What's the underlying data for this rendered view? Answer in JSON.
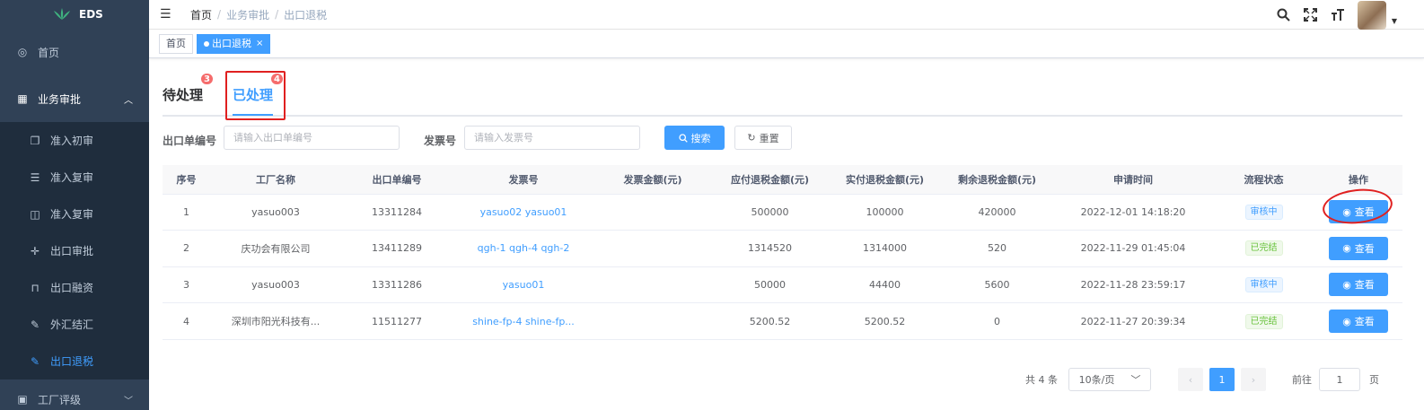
{
  "app": {
    "name": "EDS"
  },
  "sidebar": {
    "items": [
      {
        "label": "首页",
        "icon": "dashboard-icon"
      },
      {
        "label": "业务审批",
        "icon": "table-icon",
        "expanded": true,
        "children": [
          {
            "label": "准入初审",
            "icon": "copy-doc-icon"
          },
          {
            "label": "准入复审",
            "icon": "list-icon"
          },
          {
            "label": "准入复审",
            "icon": "book-icon"
          },
          {
            "label": "出口审批",
            "icon": "move-icon"
          },
          {
            "label": "出口融资",
            "icon": "finance-icon"
          },
          {
            "label": "外汇结汇",
            "icon": "edit-doc-icon"
          },
          {
            "label": "出口退税",
            "icon": "edit-doc-icon",
            "active": true
          }
        ]
      },
      {
        "label": "工厂评级",
        "icon": "grade-icon"
      }
    ]
  },
  "breadcrumb": [
    "首页",
    "业务审批",
    "出口退税"
  ],
  "tags": [
    {
      "label": "首页",
      "active": false
    },
    {
      "label": "出口退税",
      "active": true,
      "close": "×"
    }
  ],
  "tabs": [
    {
      "label": "待处理",
      "badge": "3"
    },
    {
      "label": "已处理",
      "badge": "4",
      "active": true
    }
  ],
  "search": {
    "export_no_label": "出口单编号",
    "export_no_placeholder": "请输入出口单编号",
    "invoice_label": "发票号",
    "invoice_placeholder": "请输入发票号",
    "search_button": "搜索",
    "reset_button": "重置"
  },
  "table": {
    "headers": [
      "序号",
      "工厂名称",
      "出口单编号",
      "发票号",
      "发票金额(元)",
      "应付退税金额(元)",
      "实付退税金额(元)",
      "剩余退税金额(元)",
      "申请时间",
      "流程状态",
      "操作"
    ],
    "rows": [
      {
        "no": "1",
        "factory": "yasuo003",
        "export_no": "13311284",
        "invoice": "yasuo02 yasuo01",
        "invoice_amount": "",
        "payable": "500000",
        "paid": "100000",
        "remaining": "420000",
        "time": "2022-12-01 14:18:20",
        "status": "审核中",
        "status_type": "running",
        "action": "查看"
      },
      {
        "no": "2",
        "factory": "庆功会有限公司",
        "export_no": "13411289",
        "invoice": "qgh-1 qgh-4 qgh-2",
        "invoice_amount": "",
        "payable": "1314520",
        "paid": "1314000",
        "remaining": "520",
        "time": "2022-11-29 01:45:04",
        "status": "已完结",
        "status_type": "done",
        "action": "查看"
      },
      {
        "no": "3",
        "factory": "yasuo003",
        "export_no": "13311286",
        "invoice": "yasuo01",
        "invoice_amount": "",
        "payable": "50000",
        "paid": "44400",
        "remaining": "5600",
        "time": "2022-11-28 23:59:17",
        "status": "审核中",
        "status_type": "running",
        "action": "查看"
      },
      {
        "no": "4",
        "factory": "深圳市阳光科技有...",
        "export_no": "11511277",
        "invoice": "shine-fp-4 shine-fp...",
        "invoice_amount": "",
        "payable": "5200.52",
        "paid": "5200.52",
        "remaining": "0",
        "time": "2022-11-27 20:39:34",
        "status": "已完结",
        "status_type": "done",
        "action": "查看"
      }
    ]
  },
  "pagination": {
    "total": "共 4 条",
    "page_size": "10条/页",
    "prev": "‹",
    "current": "1",
    "next": "›",
    "goto_label": "前往",
    "goto_value": "1",
    "unit": "页"
  },
  "colors": {
    "primary": "#409eff",
    "sidebar": "#304156",
    "danger": "#f56c6c",
    "success": "#67c23a",
    "annotation": "#e02020"
  }
}
